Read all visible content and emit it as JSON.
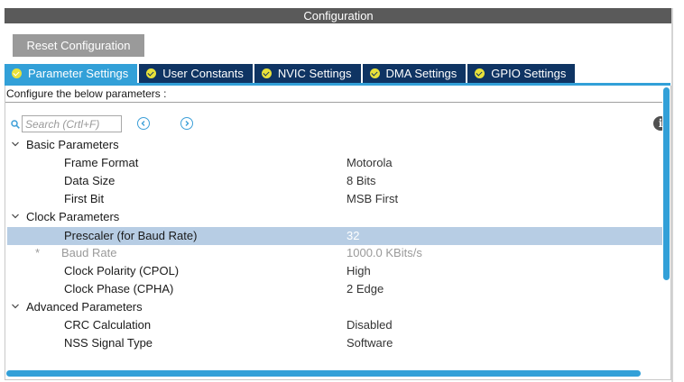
{
  "header": {
    "title": "Configuration"
  },
  "toolbar": {
    "reset_label": "Reset Configuration"
  },
  "tabs": [
    {
      "label": "Parameter Settings",
      "active": true
    },
    {
      "label": "User Constants",
      "active": false
    },
    {
      "label": "NVIC Settings",
      "active": false
    },
    {
      "label": "DMA Settings",
      "active": false
    },
    {
      "label": "GPIO Settings",
      "active": false
    }
  ],
  "panel": {
    "description": "Configure the below parameters :",
    "search": {
      "placeholder": "Search (Crtl+F)",
      "value": ""
    }
  },
  "groups": [
    {
      "title": "Basic Parameters",
      "params": [
        {
          "name": "Frame Format",
          "value": "Motorola"
        },
        {
          "name": "Data Size",
          "value": "8 Bits"
        },
        {
          "name": "First Bit",
          "value": "MSB First"
        }
      ]
    },
    {
      "title": "Clock Parameters",
      "params": [
        {
          "name": "Prescaler (for Baud Rate)",
          "value": "32",
          "selected": true
        },
        {
          "name": "Baud Rate",
          "value": "1000.0 KBits/s",
          "readonly": true,
          "marker": "*"
        },
        {
          "name": "Clock Polarity (CPOL)",
          "value": "High"
        },
        {
          "name": "Clock Phase (CPHA)",
          "value": "2 Edge"
        }
      ]
    },
    {
      "title": "Advanced Parameters",
      "params": [
        {
          "name": "CRC Calculation",
          "value": "Disabled"
        },
        {
          "name": "NSS Signal Type",
          "value": "Software"
        }
      ]
    }
  ],
  "colors": {
    "accent": "#32a0d8",
    "tab_inactive": "#0f3463",
    "selected_row": "#b7cde4",
    "check": "#e8e13a"
  },
  "icons": {
    "search": "search-icon",
    "prev": "chevron-left-icon",
    "next": "chevron-right-icon",
    "info": "info-icon",
    "collapse": "chevron-down-icon",
    "tab_status": "check-circle-icon"
  },
  "info_glyph": "i"
}
